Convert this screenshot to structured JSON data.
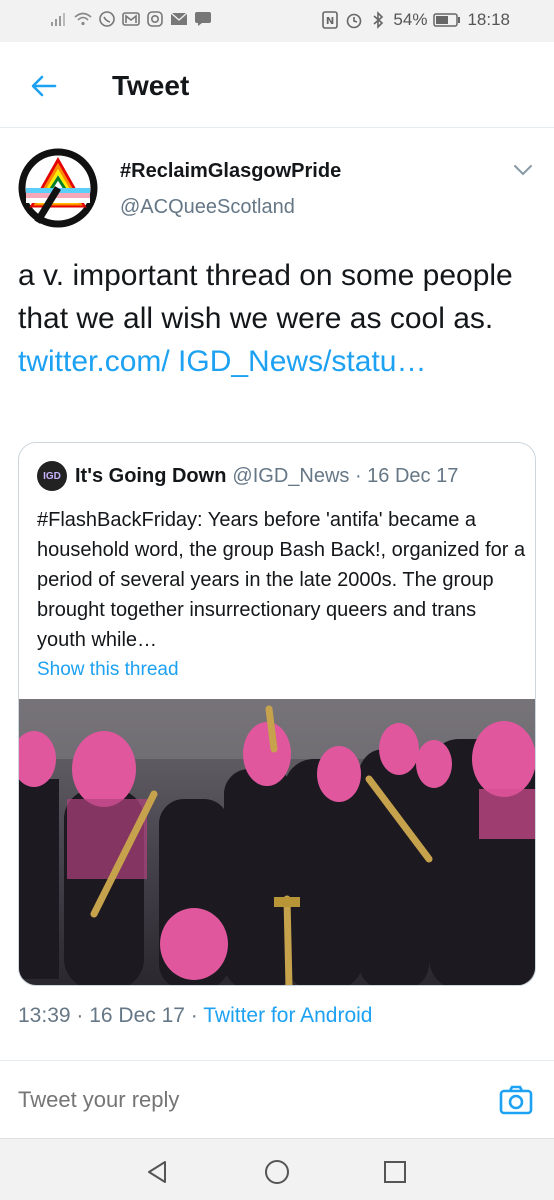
{
  "status_bar": {
    "battery": "54%",
    "time": "18:18",
    "left_icons": [
      "signal-icon",
      "wifi-icon",
      "whatsapp-icon",
      "gmail-icon",
      "instagram-icon",
      "mail-icon",
      "message-icon"
    ],
    "right_icons": [
      "nfc-icon",
      "alarm-icon",
      "bluetooth-icon",
      "battery-icon"
    ]
  },
  "app_bar": {
    "title": "Tweet"
  },
  "tweet": {
    "author_name": "#ReclaimGlasgowPride",
    "author_handle": "@ACQueeScotland",
    "text": "a v. important thread on some people that we all wish we were as cool as.",
    "link": "twitter.com/ IGD_News/statu…",
    "timestamp": "13:39 · 16 Dec 17 ·",
    "source": "Twitter for Android"
  },
  "quoted_tweet": {
    "avatar_label": "IGD",
    "name": "It's Going Down",
    "handle": "@IGD_News · 16 Dec 17",
    "text": "#FlashBackFriday: Years before 'antifa' became a household word, the group Bash Back!, organized for a period of several years in the late 2000s. The group brought together insurrectionary queers and trans youth while…",
    "show_thread": "Show this thread"
  },
  "reply": {
    "placeholder": "Tweet your reply"
  },
  "colors": {
    "accent": "#1da1f2",
    "secondary_text": "#657786",
    "border": "#ccd6dd"
  }
}
